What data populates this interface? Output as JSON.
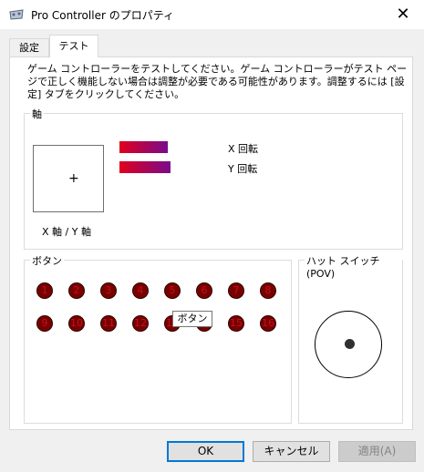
{
  "window": {
    "title": "Pro Controller のプロパティ",
    "close_glyph": "✕"
  },
  "tabs": [
    {
      "label": "設定"
    },
    {
      "label": "テスト"
    }
  ],
  "description": "ゲーム コントローラーをテストしてください。ゲーム コントローラーがテスト ページで正しく機能しない場合は調整が必要である可能性があります。調整するには [設定] タブをクリックしてください。",
  "axes": {
    "group_label": "軸",
    "xy_label": "X 軸 / Y 軸",
    "cross": "+",
    "rotation": [
      {
        "label": "X 回転",
        "fill": 0.53
      },
      {
        "label": "Y 回転",
        "fill": 0.56
      }
    ]
  },
  "buttons": {
    "group_label": "ボタン",
    "items": [
      "1",
      "2",
      "3",
      "4",
      "5",
      "6",
      "7",
      "8",
      "9",
      "10",
      "11",
      "12",
      "13",
      "14",
      "15",
      "16"
    ],
    "tooltip": "ボタン"
  },
  "pov": {
    "group_label": "ハット スイッチ (POV)"
  },
  "footer": {
    "ok": "OK",
    "cancel": "キャンセル",
    "apply": "適用(A)"
  }
}
